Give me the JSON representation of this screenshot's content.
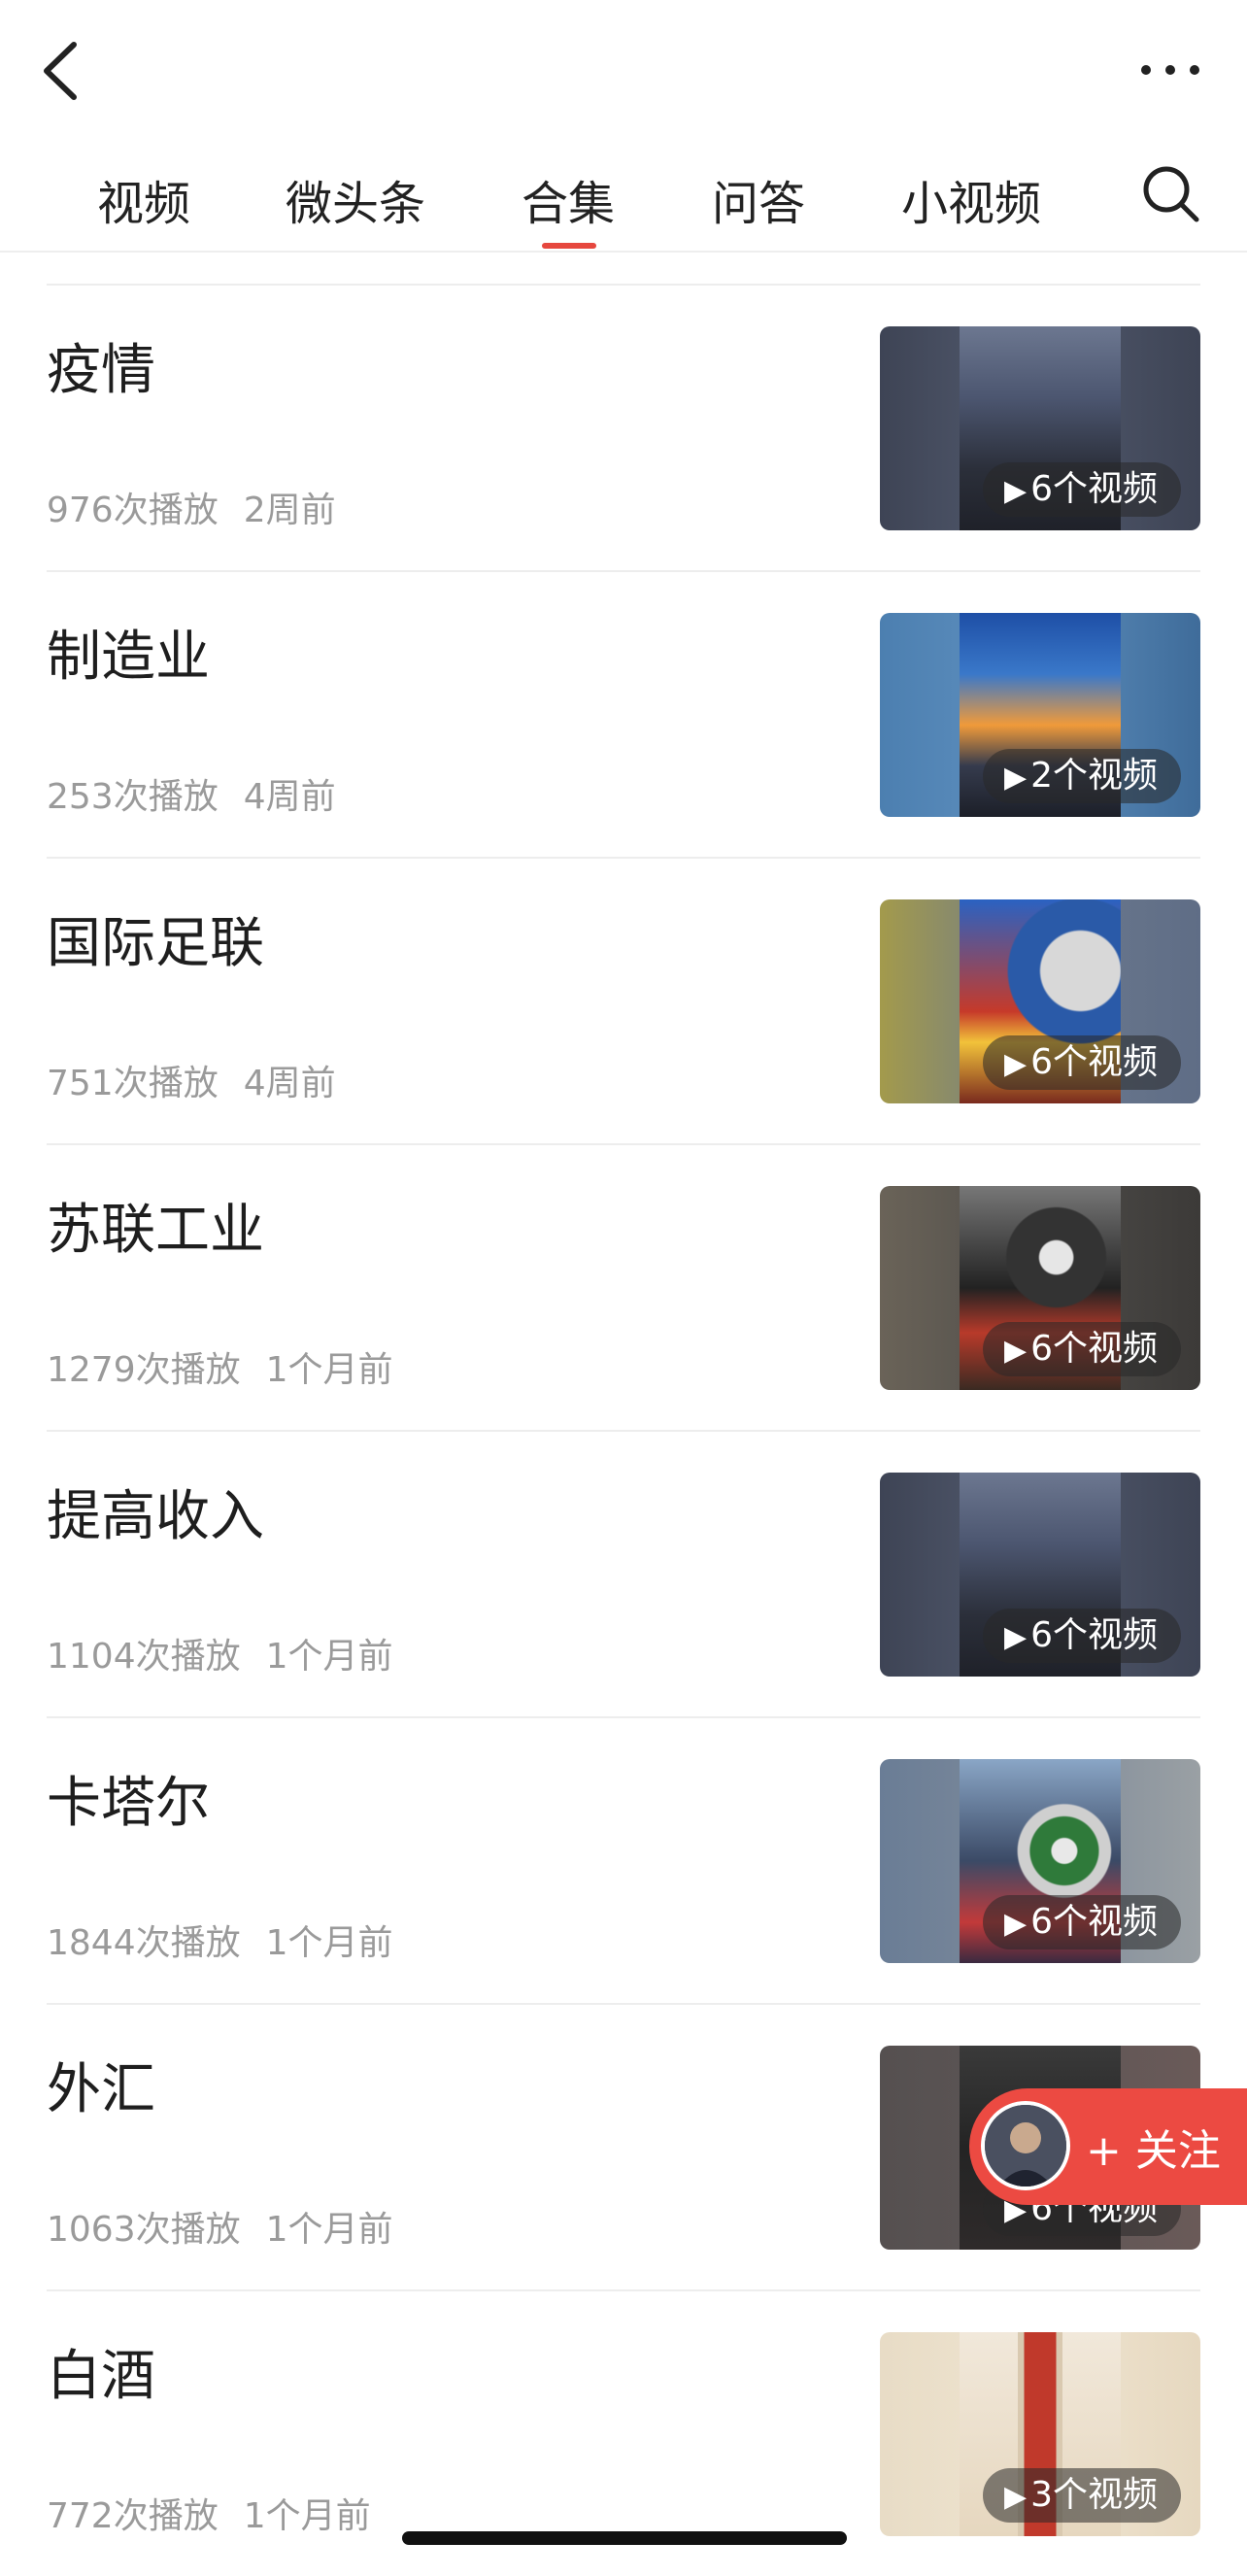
{
  "header": {
    "back_icon": "chevron-left-icon",
    "more_icon": "more-dots-icon",
    "search_icon": "search-icon"
  },
  "tabs": [
    {
      "label": "视频"
    },
    {
      "label": "微头条"
    },
    {
      "label": "合集",
      "active": true
    },
    {
      "label": "问答"
    },
    {
      "label": "小视频"
    }
  ],
  "collections": [
    {
      "title": "疫情",
      "plays": "976次播放",
      "time": "2周前",
      "count": "6个视频",
      "thumb": "city skyline at dusk"
    },
    {
      "title": "制造业",
      "plays": "253次播放",
      "time": "4周前",
      "count": "2个视频",
      "thumb": "city sunset"
    },
    {
      "title": "国际足联",
      "plays": "751次播放",
      "time": "4周前",
      "count": "6个视频",
      "thumb": "football graphic with magnifier"
    },
    {
      "title": "苏联工业",
      "plays": "1279次播放",
      "time": "1个月前",
      "count": "6个视频",
      "thumb": "magnifier over buildings"
    },
    {
      "title": "提高收入",
      "plays": "1104次播放",
      "time": "1个月前",
      "count": "6个视频",
      "thumb": "city skyline at dusk"
    },
    {
      "title": "卡塔尔",
      "plays": "1844次播放",
      "time": "1个月前",
      "count": "6个视频",
      "thumb": "skyline with stadium"
    },
    {
      "title": "外汇",
      "plays": "1063次播放",
      "time": "1个月前",
      "count": "6个视频",
      "thumb": "dark graphic"
    },
    {
      "title": "白酒",
      "plays": "772次播放",
      "time": "1个月前",
      "count": "3个视频",
      "thumb": "baijiu bottle"
    }
  ],
  "follow_button": {
    "label": "+ 关注",
    "avatar_icon": "user-avatar"
  },
  "colors": {
    "accent": "#e6473e",
    "follow_bg": "#ec4a42",
    "meta_text": "#9a9a9a"
  }
}
